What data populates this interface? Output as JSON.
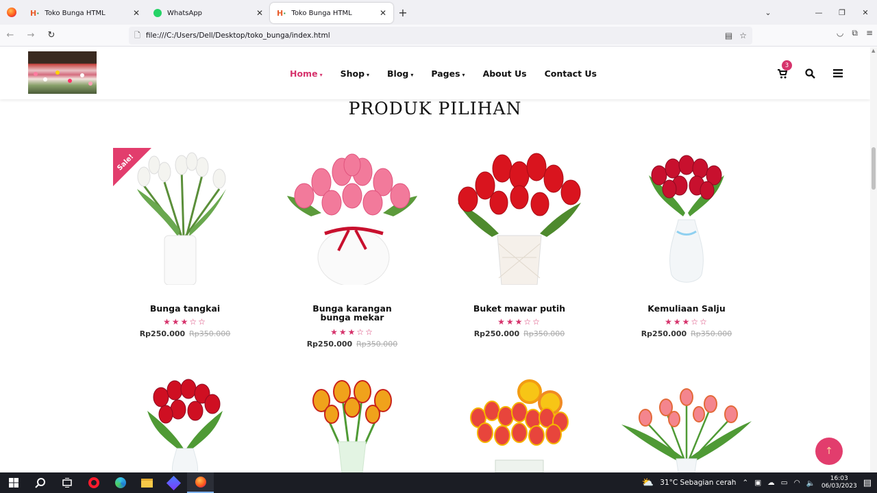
{
  "browser": {
    "tabs": [
      {
        "title": "Toko Bunga HTML",
        "favicon": "h5-icon",
        "active": false
      },
      {
        "title": "WhatsApp",
        "favicon": "whatsapp-icon",
        "active": false
      },
      {
        "title": "Toko Bunga HTML",
        "favicon": "h5-icon",
        "active": true
      }
    ],
    "url": "file:///C:/Users/Dell/Desktop/toko_bunga/index.html"
  },
  "site": {
    "menu": [
      {
        "label": "Home",
        "dropdown": true,
        "active": true
      },
      {
        "label": "Shop",
        "dropdown": true
      },
      {
        "label": "Blog",
        "dropdown": true
      },
      {
        "label": "Pages",
        "dropdown": true
      },
      {
        "label": "About Us",
        "dropdown": false
      },
      {
        "label": "Contact Us",
        "dropdown": false
      }
    ],
    "cart_count": "3",
    "section_title": "PRODUK PILIHAN",
    "sale_badge": "Sale!",
    "products": [
      {
        "name": "Bunga tangkai",
        "stars": "★★★☆☆",
        "price": "Rp250.000",
        "old_price": "Rp350.000",
        "rating": 3
      },
      {
        "name": "Bunga karangan bunga mekar",
        "stars": "★★★☆☆",
        "price": "Rp250.000",
        "old_price": "Rp350.000",
        "rating": 3
      },
      {
        "name": "Buket mawar putih",
        "stars": "★★★☆☆",
        "price": "Rp250.000",
        "old_price": "Rp350.000",
        "rating": 3
      },
      {
        "name": "Kemuliaan Salju",
        "stars": "★★★☆☆",
        "price": "Rp250.000",
        "old_price": "Rp350.000",
        "rating": 3
      }
    ],
    "accent_color": "#d6336c"
  },
  "taskbar": {
    "weather": "31°C  Sebagian cerah",
    "time": "16:03",
    "date": "06/03/2023"
  }
}
